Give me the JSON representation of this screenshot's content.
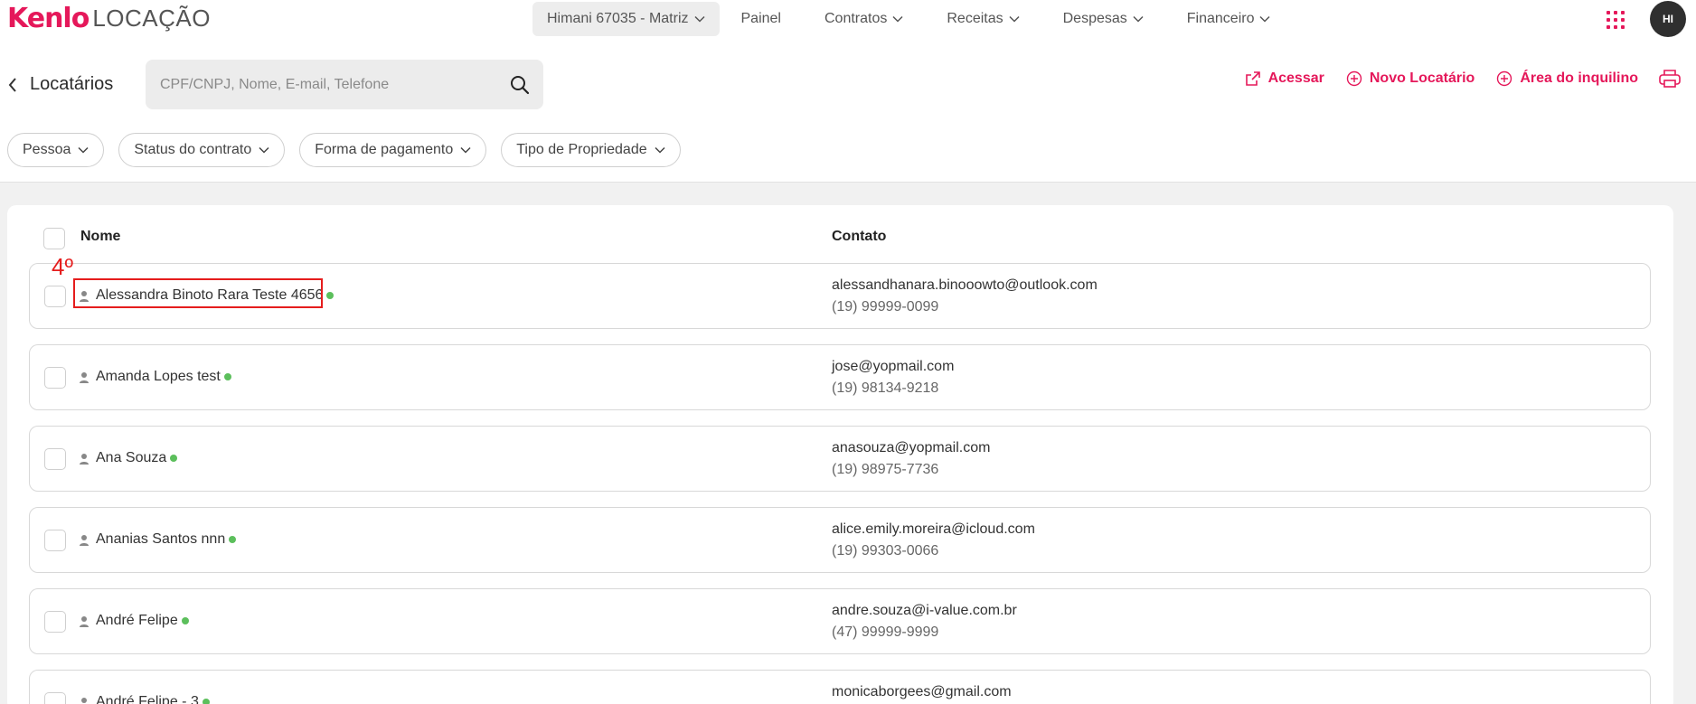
{
  "app": {
    "brand": "Kenlo",
    "product": "LOCAÇÃO"
  },
  "nav": {
    "company": "Himani 67035 - Matriz",
    "items": [
      {
        "label": "Painel",
        "has_menu": false
      },
      {
        "label": "Contratos",
        "has_menu": true
      },
      {
        "label": "Receitas",
        "has_menu": true
      },
      {
        "label": "Despesas",
        "has_menu": true
      },
      {
        "label": "Financeiro",
        "has_menu": true
      }
    ]
  },
  "user": {
    "initials": "HI"
  },
  "page": {
    "title": "Locatários",
    "search_placeholder": "CPF/CNPJ, Nome, E-mail, Telefone"
  },
  "actions": {
    "access": "Acessar",
    "new_tenant": "Novo Locatário",
    "tenant_area": "Área do inquilino"
  },
  "filters": [
    "Pessoa",
    "Status do contrato",
    "Forma de pagamento",
    "Tipo de Propriedade"
  ],
  "table": {
    "col_name": "Nome",
    "col_contact": "Contato",
    "rows": [
      {
        "name": "Alessandra Binoto Rara Teste 4656",
        "email": "alessandhanara.binooowto@outlook.com",
        "phone": "(19) 99999-0099"
      },
      {
        "name": "Amanda Lopes test",
        "email": "jose@yopmail.com",
        "phone": "(19) 98134-9218"
      },
      {
        "name": "Ana Souza",
        "email": "anasouza@yopmail.com",
        "phone": "(19) 98975-7736"
      },
      {
        "name": "Ananias Santos nnn",
        "email": "alice.emily.moreira@icloud.com",
        "phone": "(19) 99303-0066"
      },
      {
        "name": "André Felipe",
        "email": "andre.souza@i-value.com.br",
        "phone": "(47) 99999-9999"
      },
      {
        "name": "André Felipe - 3",
        "email": "monicaborgees@gmail.com",
        "phone": ""
      }
    ]
  },
  "annotation": {
    "label": "4º"
  },
  "colors": {
    "accent": "#e5185a",
    "status_active": "#5cbf5c",
    "annotation": "#e51d1d"
  }
}
